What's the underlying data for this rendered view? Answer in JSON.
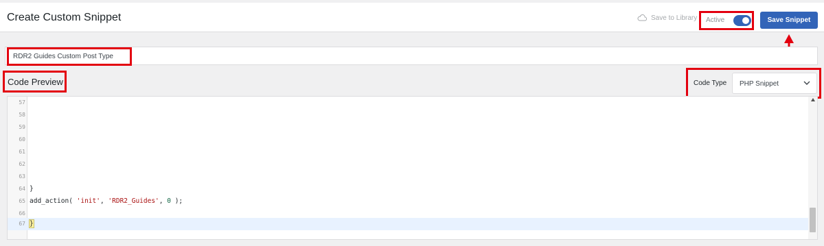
{
  "header": {
    "title": "Create Custom Snippet",
    "save_to_library": "Save to Library",
    "active_label": "Active",
    "active": true,
    "save_button": "Save Snippet"
  },
  "snippet": {
    "title_value": "RDR2 Guides Custom Post Type",
    "code_preview_label": "Code Preview",
    "code_type_label": "Code Type",
    "code_type_value": "PHP Snippet"
  },
  "editor": {
    "lines": [
      {
        "n": "57",
        "code": ""
      },
      {
        "n": "58",
        "code": ""
      },
      {
        "n": "59",
        "code": ""
      },
      {
        "n": "60",
        "code": ""
      },
      {
        "n": "61",
        "code": ""
      },
      {
        "n": "62",
        "code": ""
      },
      {
        "n": "63",
        "code": ""
      },
      {
        "n": "64",
        "code": "}"
      },
      {
        "n": "65",
        "code": "add_action( 'init', 'RDR2_Guides', 0 );"
      },
      {
        "n": "66",
        "code": ""
      },
      {
        "n": "67",
        "code": "}"
      }
    ]
  },
  "colors": {
    "accent": "#3264b8",
    "highlight_border": "#e3000f"
  },
  "icons": {
    "save_to_library": "cloud-icon",
    "select": "chevron-down-icon",
    "annotation": "arrow-up-icon"
  }
}
